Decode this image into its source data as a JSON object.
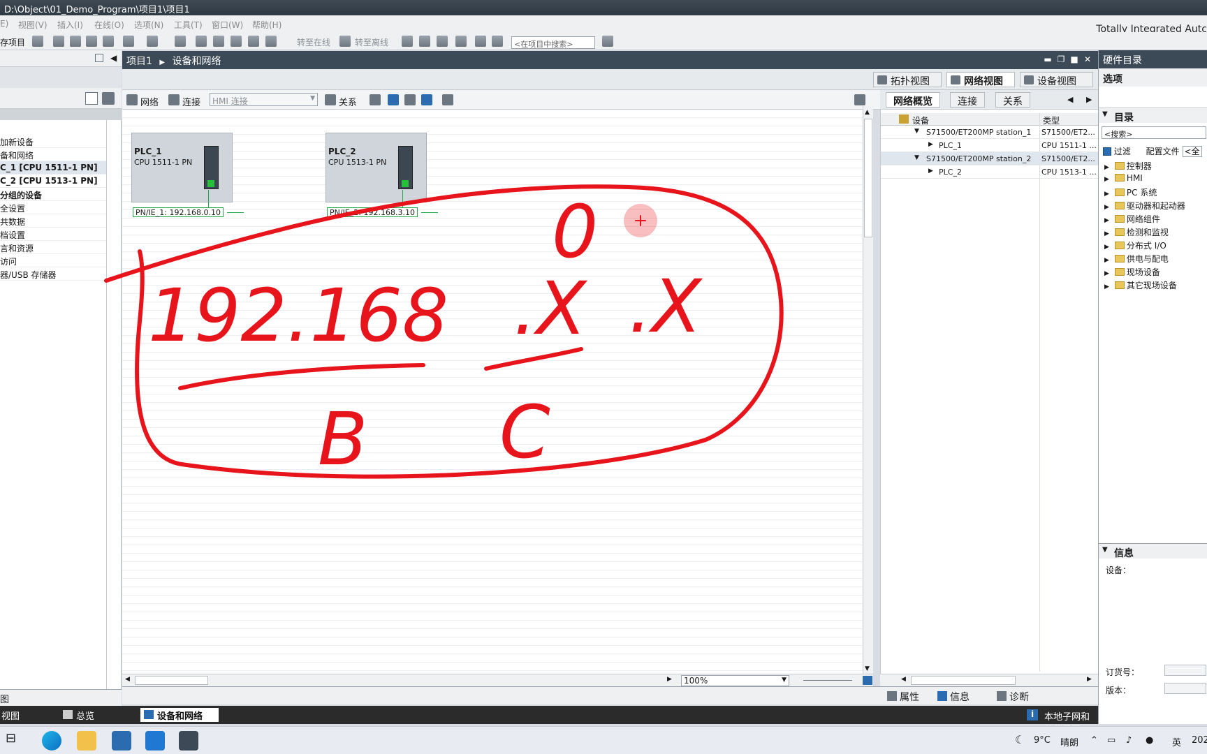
{
  "window": {
    "title": "D:\\Object\\01_Demo_Program\\项目1\\项目1",
    "brand": "Totally Integrated Autc"
  },
  "menu": [
    "E)",
    "视图(V)",
    "插入(I)",
    "在线(O)",
    "选项(N)",
    "工具(T)",
    "窗口(W)",
    "帮助(H)"
  ],
  "toolbar": {
    "save_label": "存项目",
    "go_online": "转至在线",
    "go_offline": "转至离线",
    "search_placeholder": "<在项目中搜索>"
  },
  "project_tree": {
    "items": [
      {
        "label": "加新设备",
        "selected": false,
        "bold": false
      },
      {
        "label": "备和网络",
        "selected": false,
        "bold": false
      },
      {
        "label": "C_1 [CPU 1511-1 PN]",
        "selected": true,
        "bold": true
      },
      {
        "label": "C_2 [CPU 1513-1 PN]",
        "selected": false,
        "bold": true
      },
      {
        "label": "分组的设备",
        "selected": false,
        "bold": true
      },
      {
        "label": "全设置",
        "selected": false,
        "bold": false
      },
      {
        "label": "共数据",
        "selected": false,
        "bold": false
      },
      {
        "label": "档设置",
        "selected": false,
        "bold": false
      },
      {
        "label": "言和资源",
        "selected": false,
        "bold": false
      },
      {
        "label": "访问",
        "selected": false,
        "bold": false
      },
      {
        "label": "器/USB 存储器",
        "selected": false,
        "bold": false
      }
    ],
    "bottom_label": "图"
  },
  "editor": {
    "breadcrumb": [
      "项目1",
      "设备和网络"
    ],
    "view_tabs": [
      {
        "label": "拓扑视图",
        "active": false
      },
      {
        "label": "网络视图",
        "active": true
      },
      {
        "label": "设备视图",
        "active": false
      }
    ],
    "tools": {
      "network": "网络",
      "connections": "连接",
      "hmi_select": "HMI 连接",
      "relations": "关系"
    },
    "zoom": "100%"
  },
  "devices": [
    {
      "name": "PLC_1",
      "type": "CPU 1511-1 PN",
      "interface": "PN/IE_1:  192.168.0.10"
    },
    {
      "name": "PLC_2",
      "type": "CPU 1513-1 PN",
      "interface": "PN/IE_2:  192.168.3.10"
    }
  ],
  "network_overview": {
    "tabs": [
      {
        "label": "网络概览",
        "active": true
      },
      {
        "label": "连接",
        "active": false
      },
      {
        "label": "关系",
        "active": false
      }
    ],
    "columns": [
      "设备",
      "类型"
    ],
    "rows": [
      {
        "device": "S71500/ET200MP station_1",
        "type": "S71500/ET2...",
        "level": 0,
        "selected": false
      },
      {
        "device": "PLC_1",
        "type": "CPU 1511-1 ...",
        "level": 1,
        "selected": false
      },
      {
        "device": "S71500/ET200MP station_2",
        "type": "S71500/ET2...",
        "level": 0,
        "selected": true
      },
      {
        "device": "PLC_2",
        "type": "CPU 1513-1 ...",
        "level": 1,
        "selected": false
      }
    ]
  },
  "inspector_tabs": [
    "属性",
    "信息",
    "诊断"
  ],
  "portal_bar": {
    "items": [
      {
        "label": "视图",
        "active": false
      },
      {
        "label": "总览",
        "active": false
      },
      {
        "label": "设备和网络",
        "active": true
      }
    ],
    "status": "本地子网和伙伴子网不同"
  },
  "hardware_catalog": {
    "title": "硬件目录",
    "options": "选项",
    "catalog_header": "目录",
    "search_placeholder": "<搜索>",
    "filter_label": "过滤",
    "profile_label": "配置文件",
    "profile_value": "<全",
    "categories": [
      "控制器",
      "HMI",
      "PC 系统",
      "驱动器和起动器",
      "网络组件",
      "检测和监视",
      "分布式 I/O",
      "供电与配电",
      "现场设备",
      "其它现场设备"
    ],
    "info_header": "信息",
    "device_label": "设备：",
    "order_no_label": "订货号：",
    "version_label": "版本："
  },
  "annotation": {
    "color": "#e8141c",
    "marks": [
      "192.168",
      ".X",
      ".X",
      "0",
      "B",
      "C"
    ]
  },
  "taskbar": {
    "weather": "9°C",
    "condition": "晴朗",
    "ime": "英",
    "clock": "202"
  }
}
